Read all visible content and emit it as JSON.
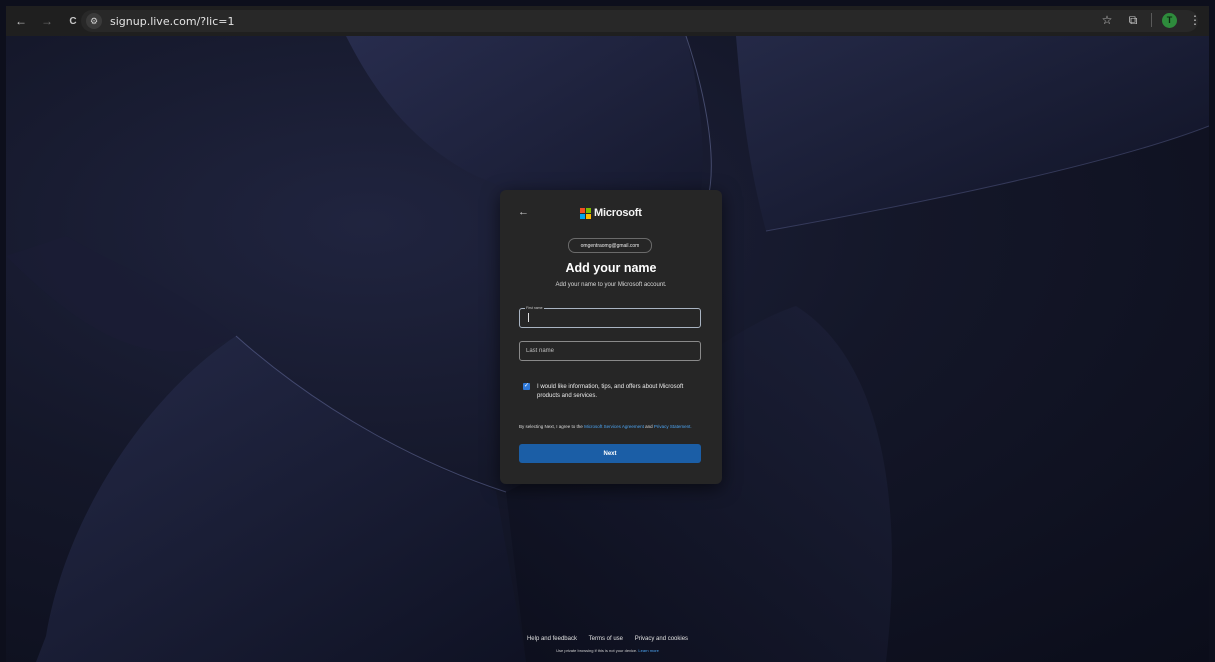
{
  "browser": {
    "url": "signup.live.com/?lic=1",
    "back_icon": "←",
    "forward_icon": "→",
    "reload_icon": "C",
    "star_icon": "☆",
    "extensions_icon": "⧉",
    "menu_icon": "⋮",
    "profile_initial": "T"
  },
  "card": {
    "back_arrow": "←",
    "brand": "Microsoft",
    "email": "omgentraomg@gmail.com",
    "title": "Add your name",
    "subtitle": "Add your name to your Microsoft account.",
    "first_name_label": "First name",
    "first_name_value": "",
    "last_name_placeholder": "Last name",
    "checkbox_checked": true,
    "checkbox_text": "I would like information, tips, and offers about Microsoft products and services.",
    "legal_prefix": "By selecting Next, I agree to the",
    "legal_link1": "Microsoft Services Agreement",
    "legal_and": "and",
    "legal_link2": "Privacy Statement.",
    "next_label": "Next"
  },
  "footer": {
    "help": "Help and feedback",
    "terms": "Terms of use",
    "privacy": "Privacy and cookies",
    "note": "Use private browsing if this is not your device.",
    "note_link": "Learn more"
  },
  "colors": {
    "accent": "#1b5ea6",
    "link": "#4ca3f0",
    "ms_red": "#f25022",
    "ms_green": "#7fba00",
    "ms_blue": "#00a4ef",
    "ms_yellow": "#ffb900"
  }
}
